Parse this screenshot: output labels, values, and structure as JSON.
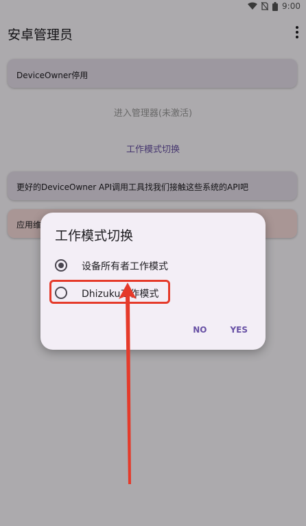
{
  "status_bar": {
    "time": "9:00",
    "icons": [
      "wifi-icon",
      "no-sim-icon",
      "battery-icon"
    ]
  },
  "app_bar": {
    "title": "安卓管理员",
    "menu_icon": "more-vert-icon"
  },
  "main": {
    "card_deviceowner": "DeviceOwner停用",
    "link_enter_admin": "进入管理器(未激活)",
    "link_work_mode": "工作模式切换",
    "card_api_tool": "更好的DeviceOwner API调用工具找我们接触这些系统的API吧",
    "card_maintenance": "应用维"
  },
  "dialog": {
    "title": "工作模式切换",
    "options": [
      {
        "label": "设备所有者工作模式",
        "selected": true
      },
      {
        "label": "Dhizuku工作模式",
        "selected": false
      }
    ],
    "no_label": "NO",
    "yes_label": "YES"
  },
  "annotation": {
    "color": "#e53a2a"
  }
}
